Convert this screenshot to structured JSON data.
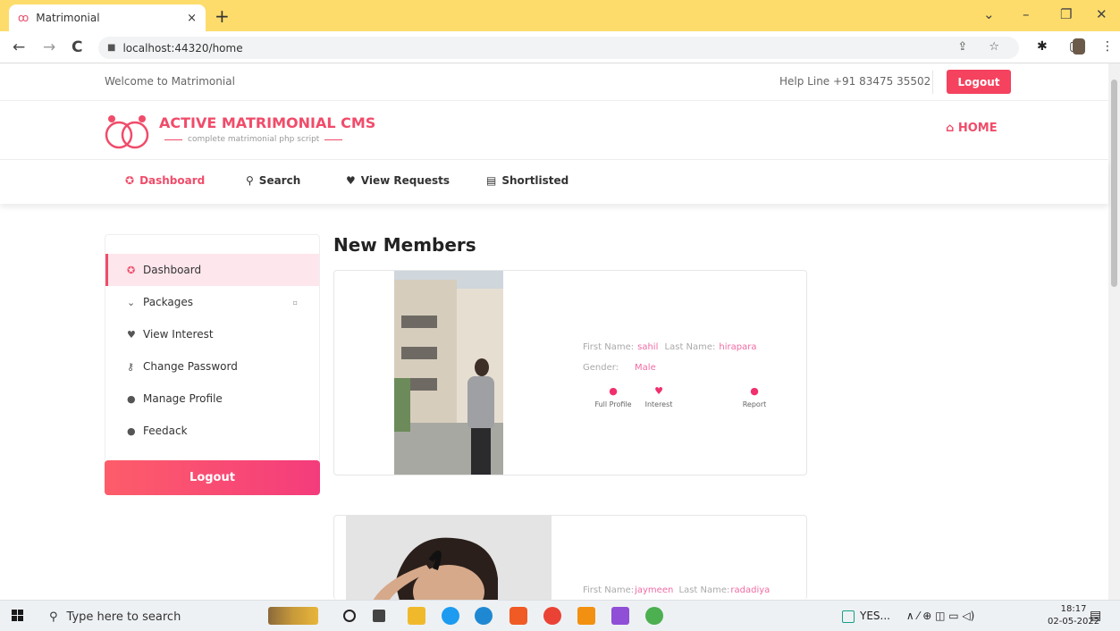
{
  "browser": {
    "tab_title": "Matrimonial",
    "tab_close": "×",
    "new_tab": "+",
    "url": "localhost:44320/home",
    "window_controls": [
      "⌄",
      "–",
      "❐",
      "✕"
    ],
    "nav": [
      "←",
      "→",
      "C"
    ],
    "url_icons": "⇪ ☆",
    "ext_icons": "✱ ▢"
  },
  "site": {
    "welcome": "Welcome to Matrimonial",
    "helpline": "Help Line +91 83475 35502",
    "logout_top": "Logout",
    "brand": "ACTIVE MATRIMONIAL CMS",
    "tagline": "complete matrimonial php script",
    "home": "HOME",
    "home_icon": "⌂",
    "menu": [
      {
        "label": "Dashboard",
        "icon": "✪"
      },
      {
        "label": "Search",
        "icon": "⚲"
      },
      {
        "label": "View Requests",
        "icon": "♥"
      },
      {
        "label": "Shortlisted",
        "icon": "▤"
      }
    ],
    "accent": "#f04c6a"
  },
  "sidebar": {
    "items": [
      {
        "label": "Dashboard",
        "icon": "✪"
      },
      {
        "label": "Packages",
        "icon": "⌄",
        "caret": "▫"
      },
      {
        "label": "View Interest",
        "icon": "♥"
      },
      {
        "label": "Change Password",
        "icon": "⚷"
      },
      {
        "label": "Manage Profile",
        "icon": "●"
      },
      {
        "label": "Feedack",
        "icon": "●"
      }
    ],
    "logout": "Logout"
  },
  "members": {
    "title": "New Members",
    "first_label": "First Name:",
    "last_label": "Last Name:",
    "gender_label": "Gender:",
    "actions": [
      {
        "label": "Full Profile",
        "icon": "●"
      },
      {
        "label": "Interest",
        "icon": "♥"
      },
      {
        "label": "Report",
        "icon": "●"
      }
    ],
    "list": [
      {
        "first_name": "sahil",
        "last_name": "hirapara",
        "gender": "Male"
      },
      {
        "first_name": "jaymeen",
        "last_name": "radadiya"
      }
    ]
  },
  "taskbar": {
    "search_placeholder": "Type here to search",
    "tray_text": "YES...",
    "tray_icons": "∧ ⁄ ⊕ ◫ ▭ ◁)",
    "time": "18:17",
    "date": "02-05-2022",
    "notif_icon": "▤"
  }
}
